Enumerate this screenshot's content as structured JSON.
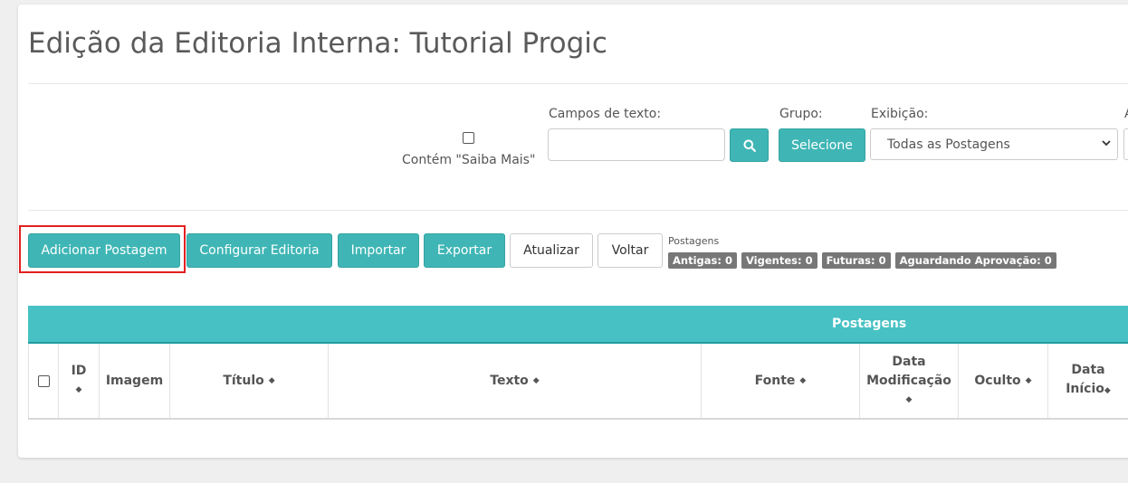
{
  "page": {
    "title": "Edição da Editoria Interna: Tutorial Progic"
  },
  "filters": {
    "saiba_mais_label": "Contém \"Saiba Mais\"",
    "text_fields_label": "Campos de texto:",
    "text_fields_value": "",
    "group_label": "Grupo:",
    "group_button": "Selecione",
    "display_label": "Exibição:",
    "display_value": "Todas as Postagens",
    "cut_off_label": "A"
  },
  "toolbar": {
    "add": "Adicionar Postagem",
    "configure": "Configurar Editoria",
    "import": "Importar",
    "export": "Exportar",
    "refresh": "Atualizar",
    "back": "Voltar"
  },
  "counts": {
    "label": "Postagens",
    "antigas": "Antigas: 0",
    "vigentes": "Vigentes: 0",
    "futuras": "Futuras: 0",
    "aguardando": "Aguardando Aprovação: 0"
  },
  "table": {
    "caption": "Postagens",
    "columns": {
      "id": "ID",
      "imagem": "Imagem",
      "titulo": "Título",
      "texto": "Texto",
      "fonte": "Fonte",
      "data_mod_1": "Data",
      "data_mod_2": "Modificação",
      "oculto": "Oculto",
      "data_ini_1": "Data",
      "data_ini_2": "Início"
    }
  },
  "colors": {
    "accent": "#3fb6b5",
    "table_header": "#47c1c4",
    "badge": "#777777",
    "highlight": "#e32020"
  }
}
